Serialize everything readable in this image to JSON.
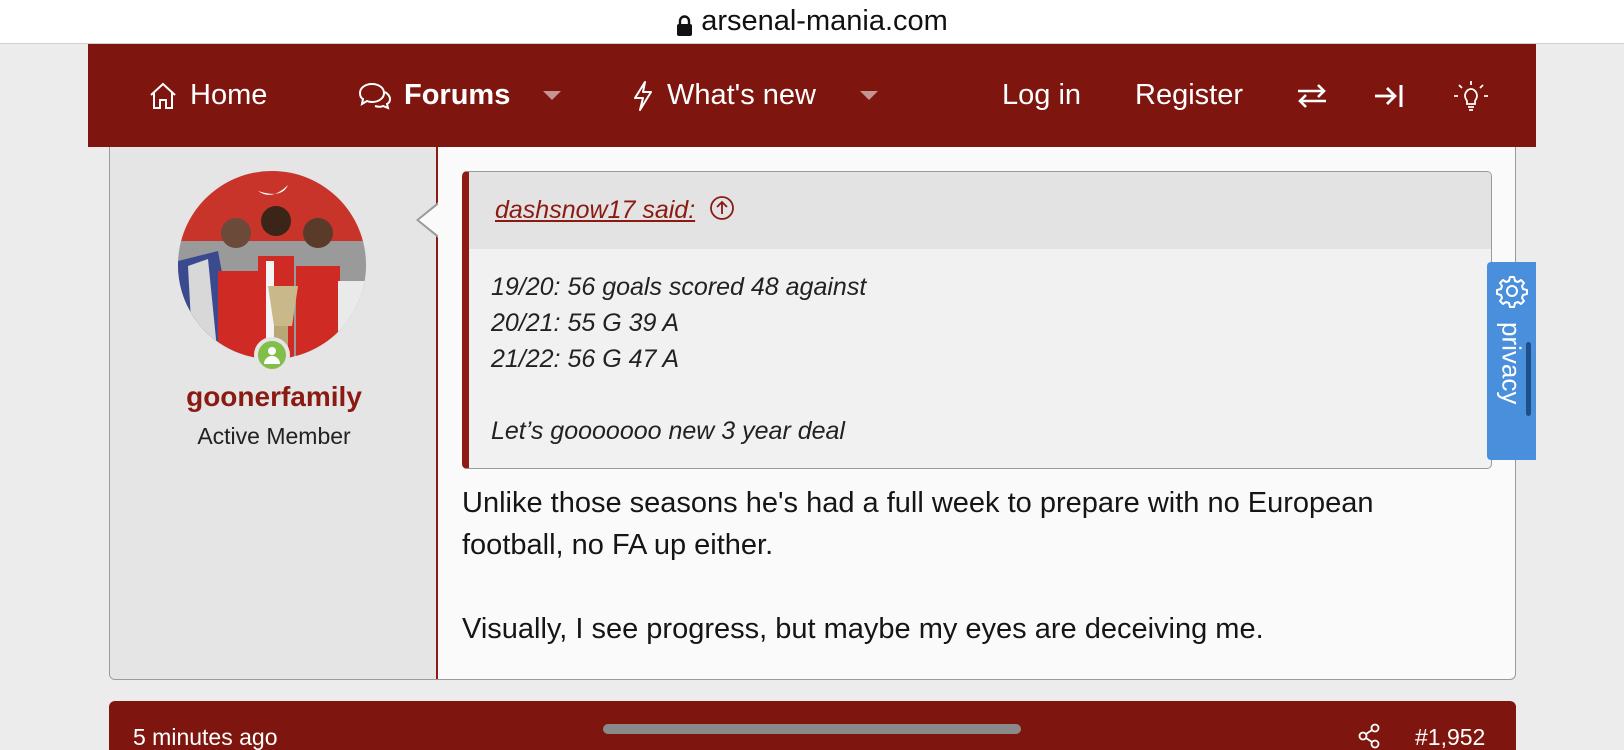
{
  "browser": {
    "url": "arsenal-mania.com"
  },
  "nav": {
    "home": "Home",
    "forums": "Forums",
    "whats_new": "What's new",
    "login": "Log in",
    "register": "Register"
  },
  "post": {
    "username": "goonerfamily",
    "user_title": "Active Member",
    "quote": {
      "author": "dashsnow17 said:",
      "lines": [
        "19/20: 56 goals scored 48 against",
        "20/21: 55 G 39 A",
        "21/22: 56 G 47 A"
      ],
      "closing": "Let’s gooooooo new 3 year deal"
    },
    "message": [
      "Unlike those seasons he's had a full week to prepare with no European football, no FA up either.",
      "Visually, I see progress, but maybe my eyes are deceiving me."
    ]
  },
  "privacy_tab": {
    "label": "privacy"
  },
  "next_post": {
    "time": "5 minutes ago",
    "number": "#1,952"
  },
  "colors": {
    "brand": "#7e160f",
    "accent_text": "#8a1a12",
    "privacy": "#4a8fdb",
    "online": "#7fbf4a"
  },
  "icons": [
    "lock-icon",
    "home-icon",
    "chat-icon",
    "bolt-icon",
    "swap-icon",
    "login-arrow-icon",
    "bulb-icon",
    "up-circle-icon",
    "gear-icon",
    "share-icon"
  ]
}
